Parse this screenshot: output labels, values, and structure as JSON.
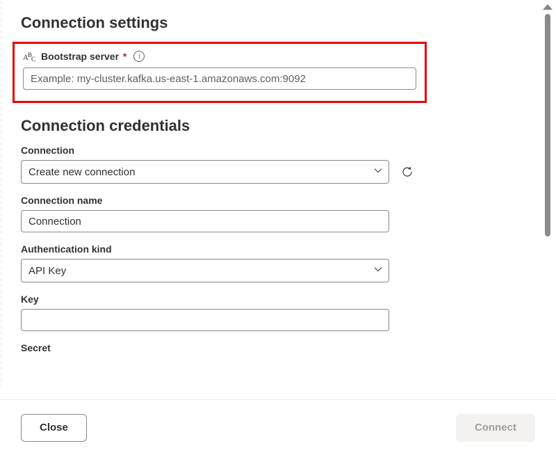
{
  "sections": {
    "connection_settings_title": "Connection settings",
    "connection_credentials_title": "Connection credentials"
  },
  "bootstrap": {
    "label": "Bootstrap server",
    "placeholder": "Example: my-cluster.kafka.us-east-1.amazonaws.com:9092",
    "value": ""
  },
  "connection_field": {
    "label": "Connection",
    "value": "Create new connection"
  },
  "connection_name": {
    "label": "Connection name",
    "value": "Connection"
  },
  "auth_kind": {
    "label": "Authentication kind",
    "value": "API Key"
  },
  "key_field": {
    "label": "Key",
    "value": ""
  },
  "secret_field": {
    "label": "Secret"
  },
  "footer": {
    "close_label": "Close",
    "connect_label": "Connect"
  }
}
